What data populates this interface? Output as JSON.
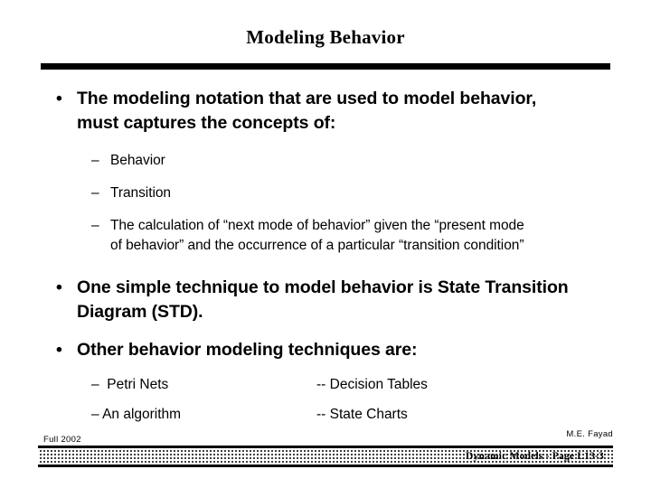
{
  "slide": {
    "title": "Modeling Behavior",
    "bullet_marker": "•",
    "dash_marker": "–",
    "content": {
      "bullet1": "The modeling notation that are used to model behavior, must captures the concepts of:",
      "sub1": "Behavior",
      "sub2": "Transition",
      "sub3": "The calculation of “next mode of behavior” given the “present mode of behavior” and the occurrence  of a particular “transition condition”",
      "bullet2": "One simple technique to model behavior is State Transition Diagram (STD).",
      "bullet3": "Other behavior modeling techniques are:"
    },
    "techniques": {
      "row1_left": "–  Petri Nets",
      "row1_right": "-- Decision Tables",
      "row2_left": "– An algorithm",
      "row2_right": "-- State Charts"
    },
    "footer": {
      "date": "Full 2002",
      "author": "M.E. Fayad",
      "bar_text": "Dynamic Models - Page L13-3"
    },
    "colors": {
      "text": "#000000",
      "background": "#ffffff",
      "rule": "#000000"
    }
  }
}
